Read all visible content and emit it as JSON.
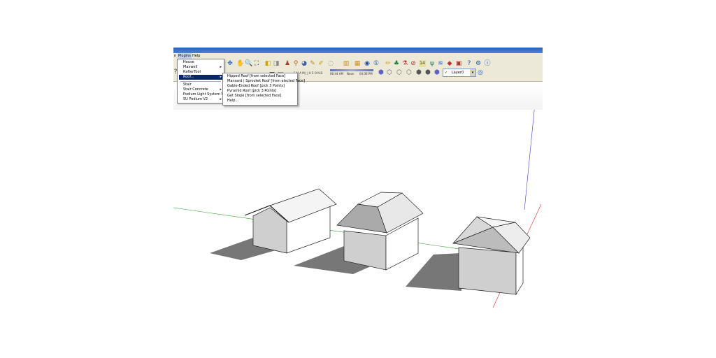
{
  "menubar": {
    "cut_label": "n",
    "plugins_label": "Plugins",
    "help_label": "Help"
  },
  "plugins_menu": {
    "items": [
      {
        "label": "House",
        "has_submenu": false
      },
      {
        "label": "Maxwell",
        "has_submenu": true
      },
      {
        "label": "RafterTool",
        "has_submenu": false
      },
      {
        "label": "Roof...",
        "has_submenu": true,
        "selected": true
      },
      {
        "label": "Stair",
        "has_submenu": false
      },
      {
        "label": "Stair Concrete",
        "has_submenu": true
      },
      {
        "label": "Podium Light System V2",
        "has_submenu": false
      },
      {
        "label": "SU Podium V2",
        "has_submenu": true
      }
    ]
  },
  "roof_submenu": {
    "items": [
      "Hipped Roof [from selected Face]",
      "Mansard | Sprocket Roof [from elected Face]",
      "Gable-Ended Roof [pick 3 Points]",
      "Pyramid Roof [pick 3 Points]",
      "Get Slope [from selected Face]",
      "Help..."
    ]
  },
  "shadow_bar": {
    "months": "F M A M J J A S O N D",
    "time_start": "06:44 AM",
    "time_noon": "Noon",
    "time_end": "04:36 PM"
  },
  "layer": {
    "current": "Layer0",
    "checked": "✓"
  },
  "colors": {
    "titlebar": "#2d5fb8",
    "menu_highlight": "#0a246a",
    "toolbar_bg": "#ece9d8",
    "axis_red": "#d03030",
    "axis_green": "#30a030",
    "axis_blue": "#3040c0"
  },
  "icons": {
    "toolbar_row1": [
      "orbit-icon",
      "pan-icon",
      "zoom-icon",
      "zoom-extents-icon",
      "previous-view-icon",
      "next-view-icon",
      "walk-icon",
      "position-camera-icon",
      "look-around-icon",
      "section-plane-icon",
      "paint-icon",
      "eraser-icon",
      "component-icon",
      "get-models-icon",
      "share-model-icon",
      "warehouse-icon",
      "info-icon",
      "pencil-icon",
      "sandbox-icon",
      "dropper-icon",
      "stop-icon",
      "counter-icon",
      "grass-icon",
      "wave-icon",
      "shield-icon",
      "export-icon",
      "help-icon",
      "settings-icon",
      "about-icon"
    ],
    "toolbar_row2": [
      "iso-view-icon",
      "top-view-icon",
      "front-view-icon",
      "right-view-icon",
      "back-view-icon",
      "left-view-icon",
      "layer-icon",
      "layer-manager-icon"
    ]
  }
}
